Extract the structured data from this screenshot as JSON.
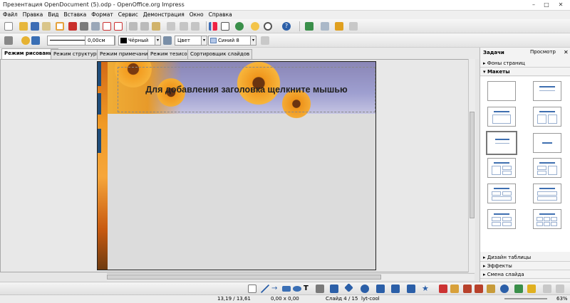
{
  "window": {
    "title": "Презентация OpenDocument (5).odp - OpenOffice.org Impress"
  },
  "menu": [
    "Файл",
    "Правка",
    "Вид",
    "Вставка",
    "Формат",
    "Сервис",
    "Демонстрация",
    "Окно",
    "Справка"
  ],
  "toolbar2": {
    "line_width": "0,00см",
    "line_color": "Чёрный",
    "fill_type": "Цвет",
    "fill_color": "Синий 8"
  },
  "view_tabs": [
    "Режим рисования",
    "Режим структуры",
    "Режим примечаний",
    "Режим тезисов",
    "Сортировщик слайдов"
  ],
  "slide": {
    "title_placeholder": "Для добавления заголовка щелкните мышью"
  },
  "task_pane": {
    "title": "Задачи",
    "view_label": "Просмотр",
    "sections": {
      "master_pages": "Фоны страниц",
      "layouts": "Макеты",
      "table_design": "Дизайн таблицы",
      "effects": "Эффекты",
      "transition": "Смена слайда"
    }
  },
  "status": {
    "position": "13,19 / 13,61",
    "size": "0,00 x 0,00",
    "slide": "Слайд 4 / 15",
    "master": "lyt-cool",
    "zoom": "63%"
  },
  "colors": {
    "accent_blue": "#3e6fb0",
    "slide_bg": "#dcdcdc",
    "tab_active": "#ffffff"
  },
  "icons": [
    "new-icon",
    "open-icon",
    "save-icon",
    "email-icon",
    "edit-icon",
    "pdf-icon",
    "print-icon",
    "preview-icon",
    "spellcheck-icon",
    "autospell-icon",
    "cut-icon",
    "copy-icon",
    "paste-icon",
    "format-paintbrush-icon",
    "undo-icon",
    "redo-icon",
    "chart-icon",
    "table-icon",
    "hyperlink-icon",
    "navigator-icon",
    "zoom-icon",
    "help-icon"
  ]
}
